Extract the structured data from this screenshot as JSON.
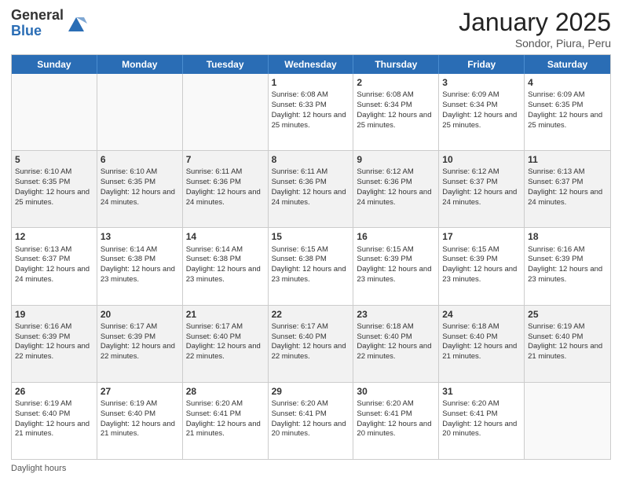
{
  "header": {
    "logo_general": "General",
    "logo_blue": "Blue",
    "month_title": "January 2025",
    "location": "Sondor, Piura, Peru"
  },
  "days_of_week": [
    "Sunday",
    "Monday",
    "Tuesday",
    "Wednesday",
    "Thursday",
    "Friday",
    "Saturday"
  ],
  "footer_label": "Daylight hours",
  "weeks": [
    [
      {
        "day": "",
        "info": ""
      },
      {
        "day": "",
        "info": ""
      },
      {
        "day": "",
        "info": ""
      },
      {
        "day": "1",
        "sunrise": "Sunrise: 6:08 AM",
        "sunset": "Sunset: 6:33 PM",
        "daylight": "Daylight: 12 hours and 25 minutes."
      },
      {
        "day": "2",
        "sunrise": "Sunrise: 6:08 AM",
        "sunset": "Sunset: 6:34 PM",
        "daylight": "Daylight: 12 hours and 25 minutes."
      },
      {
        "day": "3",
        "sunrise": "Sunrise: 6:09 AM",
        "sunset": "Sunset: 6:34 PM",
        "daylight": "Daylight: 12 hours and 25 minutes."
      },
      {
        "day": "4",
        "sunrise": "Sunrise: 6:09 AM",
        "sunset": "Sunset: 6:35 PM",
        "daylight": "Daylight: 12 hours and 25 minutes."
      }
    ],
    [
      {
        "day": "5",
        "sunrise": "Sunrise: 6:10 AM",
        "sunset": "Sunset: 6:35 PM",
        "daylight": "Daylight: 12 hours and 25 minutes."
      },
      {
        "day": "6",
        "sunrise": "Sunrise: 6:10 AM",
        "sunset": "Sunset: 6:35 PM",
        "daylight": "Daylight: 12 hours and 24 minutes."
      },
      {
        "day": "7",
        "sunrise": "Sunrise: 6:11 AM",
        "sunset": "Sunset: 6:36 PM",
        "daylight": "Daylight: 12 hours and 24 minutes."
      },
      {
        "day": "8",
        "sunrise": "Sunrise: 6:11 AM",
        "sunset": "Sunset: 6:36 PM",
        "daylight": "Daylight: 12 hours and 24 minutes."
      },
      {
        "day": "9",
        "sunrise": "Sunrise: 6:12 AM",
        "sunset": "Sunset: 6:36 PM",
        "daylight": "Daylight: 12 hours and 24 minutes."
      },
      {
        "day": "10",
        "sunrise": "Sunrise: 6:12 AM",
        "sunset": "Sunset: 6:37 PM",
        "daylight": "Daylight: 12 hours and 24 minutes."
      },
      {
        "day": "11",
        "sunrise": "Sunrise: 6:13 AM",
        "sunset": "Sunset: 6:37 PM",
        "daylight": "Daylight: 12 hours and 24 minutes."
      }
    ],
    [
      {
        "day": "12",
        "sunrise": "Sunrise: 6:13 AM",
        "sunset": "Sunset: 6:37 PM",
        "daylight": "Daylight: 12 hours and 24 minutes."
      },
      {
        "day": "13",
        "sunrise": "Sunrise: 6:14 AM",
        "sunset": "Sunset: 6:38 PM",
        "daylight": "Daylight: 12 hours and 23 minutes."
      },
      {
        "day": "14",
        "sunrise": "Sunrise: 6:14 AM",
        "sunset": "Sunset: 6:38 PM",
        "daylight": "Daylight: 12 hours and 23 minutes."
      },
      {
        "day": "15",
        "sunrise": "Sunrise: 6:15 AM",
        "sunset": "Sunset: 6:38 PM",
        "daylight": "Daylight: 12 hours and 23 minutes."
      },
      {
        "day": "16",
        "sunrise": "Sunrise: 6:15 AM",
        "sunset": "Sunset: 6:39 PM",
        "daylight": "Daylight: 12 hours and 23 minutes."
      },
      {
        "day": "17",
        "sunrise": "Sunrise: 6:15 AM",
        "sunset": "Sunset: 6:39 PM",
        "daylight": "Daylight: 12 hours and 23 minutes."
      },
      {
        "day": "18",
        "sunrise": "Sunrise: 6:16 AM",
        "sunset": "Sunset: 6:39 PM",
        "daylight": "Daylight: 12 hours and 23 minutes."
      }
    ],
    [
      {
        "day": "19",
        "sunrise": "Sunrise: 6:16 AM",
        "sunset": "Sunset: 6:39 PM",
        "daylight": "Daylight: 12 hours and 22 minutes."
      },
      {
        "day": "20",
        "sunrise": "Sunrise: 6:17 AM",
        "sunset": "Sunset: 6:39 PM",
        "daylight": "Daylight: 12 hours and 22 minutes."
      },
      {
        "day": "21",
        "sunrise": "Sunrise: 6:17 AM",
        "sunset": "Sunset: 6:40 PM",
        "daylight": "Daylight: 12 hours and 22 minutes."
      },
      {
        "day": "22",
        "sunrise": "Sunrise: 6:17 AM",
        "sunset": "Sunset: 6:40 PM",
        "daylight": "Daylight: 12 hours and 22 minutes."
      },
      {
        "day": "23",
        "sunrise": "Sunrise: 6:18 AM",
        "sunset": "Sunset: 6:40 PM",
        "daylight": "Daylight: 12 hours and 22 minutes."
      },
      {
        "day": "24",
        "sunrise": "Sunrise: 6:18 AM",
        "sunset": "Sunset: 6:40 PM",
        "daylight": "Daylight: 12 hours and 21 minutes."
      },
      {
        "day": "25",
        "sunrise": "Sunrise: 6:19 AM",
        "sunset": "Sunset: 6:40 PM",
        "daylight": "Daylight: 12 hours and 21 minutes."
      }
    ],
    [
      {
        "day": "26",
        "sunrise": "Sunrise: 6:19 AM",
        "sunset": "Sunset: 6:40 PM",
        "daylight": "Daylight: 12 hours and 21 minutes."
      },
      {
        "day": "27",
        "sunrise": "Sunrise: 6:19 AM",
        "sunset": "Sunset: 6:40 PM",
        "daylight": "Daylight: 12 hours and 21 minutes."
      },
      {
        "day": "28",
        "sunrise": "Sunrise: 6:20 AM",
        "sunset": "Sunset: 6:41 PM",
        "daylight": "Daylight: 12 hours and 21 minutes."
      },
      {
        "day": "29",
        "sunrise": "Sunrise: 6:20 AM",
        "sunset": "Sunset: 6:41 PM",
        "daylight": "Daylight: 12 hours and 20 minutes."
      },
      {
        "day": "30",
        "sunrise": "Sunrise: 6:20 AM",
        "sunset": "Sunset: 6:41 PM",
        "daylight": "Daylight: 12 hours and 20 minutes."
      },
      {
        "day": "31",
        "sunrise": "Sunrise: 6:20 AM",
        "sunset": "Sunset: 6:41 PM",
        "daylight": "Daylight: 12 hours and 20 minutes."
      },
      {
        "day": "",
        "info": ""
      }
    ]
  ]
}
